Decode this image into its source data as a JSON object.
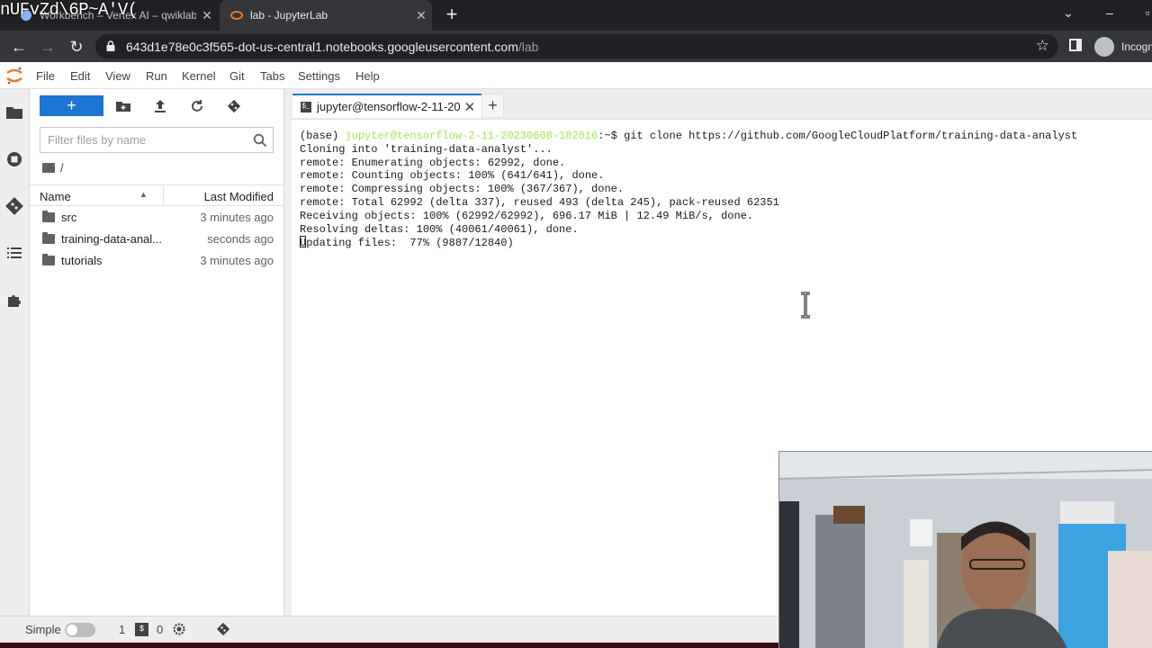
{
  "overlay": {
    "text": "nUFvZd\\6P~A'V("
  },
  "browser": {
    "tabs": [
      {
        "title": "Workbench – Vertex AI – qwiklabs",
        "active": false
      },
      {
        "title": "lab - JupyterLab",
        "active": true
      }
    ],
    "url_host": "643d1e78e0c3f565-dot-us-central1.notebooks.googleusercontent.com",
    "url_path": "/lab",
    "profile_label": "Incognito"
  },
  "menu": [
    "File",
    "Edit",
    "View",
    "Run",
    "Kernel",
    "Git",
    "Tabs",
    "Settings",
    "Help"
  ],
  "file_browser": {
    "new_label": "+",
    "search_placeholder": "Filter files by name",
    "breadcrumb": "/",
    "col_name": "Name",
    "col_modified": "Last Modified",
    "items": [
      {
        "name": "src",
        "modified": "3 minutes ago"
      },
      {
        "name": "training-data-anal...",
        "modified": "seconds ago"
      },
      {
        "name": "tutorials",
        "modified": "3 minutes ago"
      }
    ]
  },
  "dock": {
    "tab_title": "jupyter@tensorflow-2-11-20",
    "add_label": "+"
  },
  "terminal": {
    "prompt_base": "(base) ",
    "prompt_host": "jupyter@tensorflow-2-11-20230608-182016",
    "prompt_tail": ":~$ git clone https://github.com/GoogleCloudPlatform/training-data-analyst",
    "lines": [
      "Cloning into 'training-data-analyst'...",
      "remote: Enumerating objects: 62992, done.",
      "remote: Counting objects: 100% (641/641), done.",
      "remote: Compressing objects: 100% (367/367), done.",
      "remote: Total 62992 (delta 337), reused 493 (delta 245), pack-reused 62351",
      "Receiving objects: 100% (62992/62992), 696.17 MiB | 12.49 MiB/s, done.",
      "Resolving deltas: 100% (40061/40061), done."
    ],
    "last_line": "Updating files:  77% (9887/12840)"
  },
  "status": {
    "mode_label": "Simple",
    "terminals_count": "1",
    "kernels_count": "0"
  },
  "colors": {
    "accent": "#1976d2",
    "prompt_green": "#a4e84a",
    "chrome_dark": "#202124"
  }
}
